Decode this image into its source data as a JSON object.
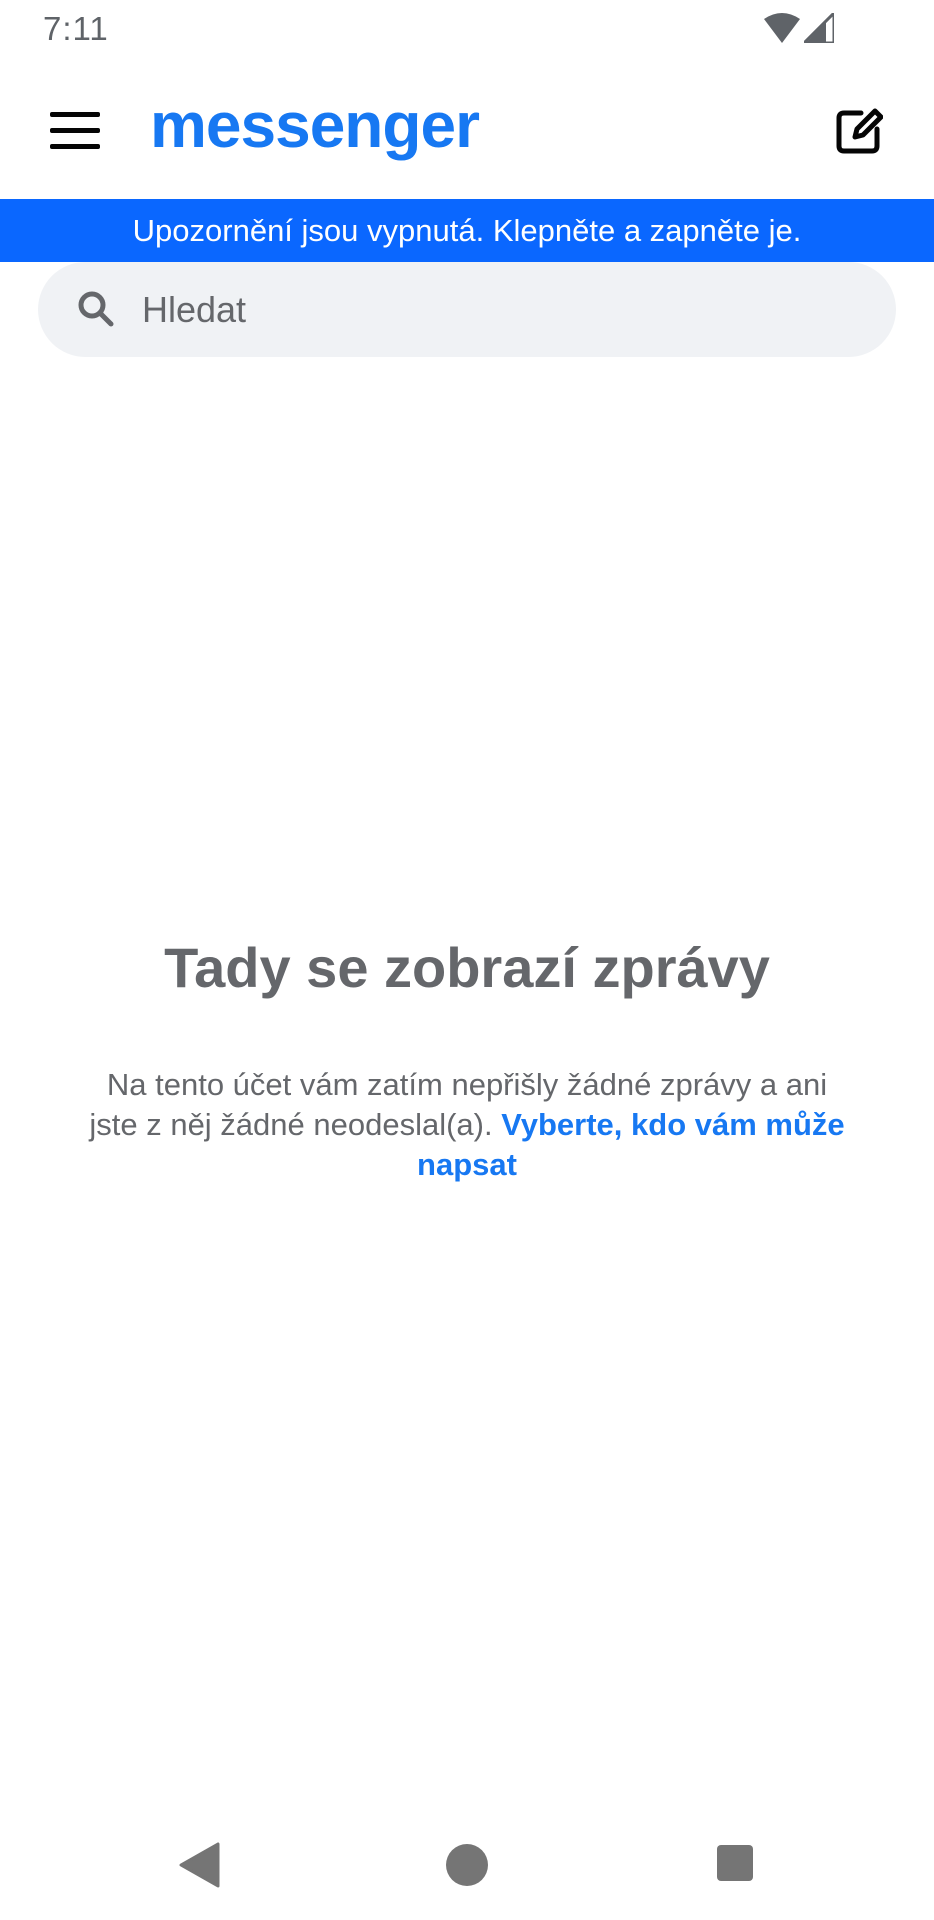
{
  "status_bar": {
    "time": "7:11",
    "icons": [
      "wifi-icon",
      "cellular-signal-icon"
    ]
  },
  "app_bar": {
    "logo_text": "messenger",
    "menu_icon": "hamburger-menu-icon",
    "compose_icon": "compose-icon",
    "brand_color": "#1778f2"
  },
  "banner": {
    "text": "Upozornění jsou vypnutá. Klepněte a zapněte je.",
    "background": "#0a67ff"
  },
  "search": {
    "placeholder": "Hledat",
    "value": ""
  },
  "empty_state": {
    "title": "Tady se zobrazí zprávy",
    "body": "Na tento účet vám zatím nepřišly žádné zprávy a ani jste z něj žádné neodeslal(a). ",
    "link": "Vyberte, kdo vám může napsat"
  },
  "nav_bar": {
    "icons": [
      "back-icon",
      "home-icon",
      "recents-icon"
    ]
  }
}
